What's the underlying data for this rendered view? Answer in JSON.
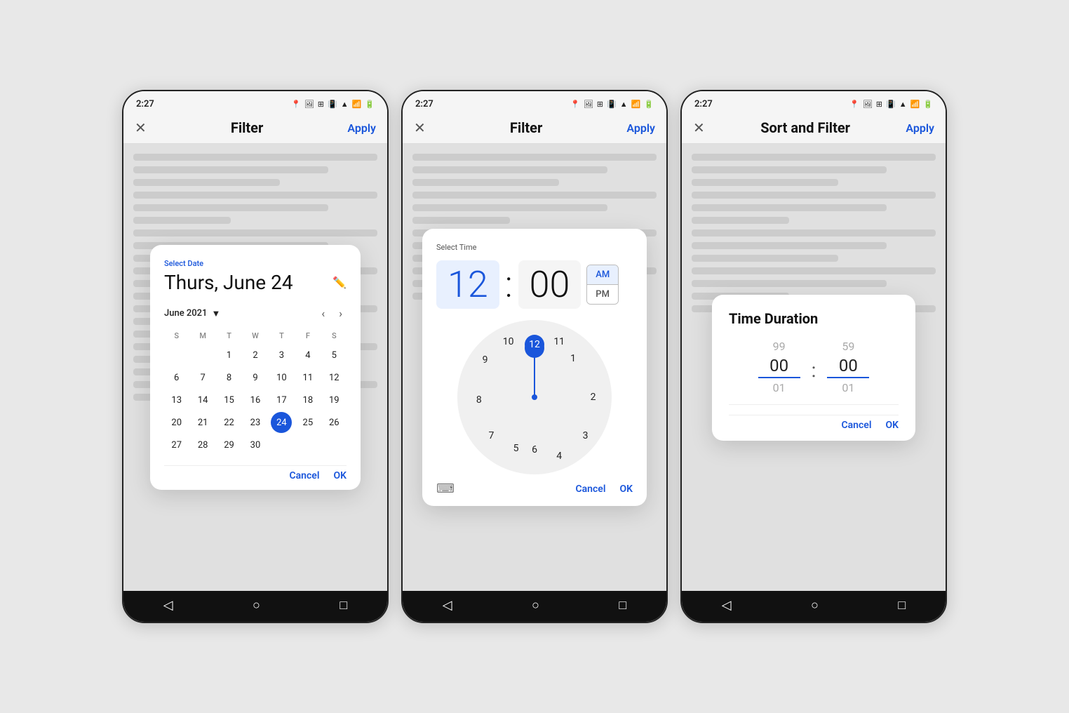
{
  "phones": [
    {
      "id": "date-picker",
      "statusTime": "2:27",
      "appBarTitle": "Filter",
      "applyLabel": "Apply",
      "dialog": {
        "type": "calendar",
        "selectLabel": "Select Date",
        "bigDate": "Thurs, June 24",
        "monthYear": "June 2021",
        "dayHeaders": [
          "S",
          "M",
          "T",
          "W",
          "T",
          "F",
          "S"
        ],
        "weeks": [
          [
            "",
            "",
            "1",
            "2",
            "3",
            "4",
            "5"
          ],
          [
            "6",
            "7",
            "8",
            "9",
            "10",
            "11",
            "12"
          ],
          [
            "13",
            "14",
            "15",
            "16",
            "17",
            "18",
            "19"
          ],
          [
            "20",
            "21",
            "22",
            "23",
            "24",
            "25",
            "26"
          ],
          [
            "27",
            "28",
            "29",
            "30",
            "",
            "",
            ""
          ]
        ],
        "selectedDay": "24",
        "cancelLabel": "Cancel",
        "okLabel": "OK"
      }
    },
    {
      "id": "time-picker",
      "statusTime": "2:27",
      "appBarTitle": "Filter",
      "applyLabel": "Apply",
      "dialog": {
        "type": "time",
        "selectLabel": "Select Time",
        "hours": "12",
        "minutes": "00",
        "amSelected": true,
        "amLabel": "AM",
        "pmLabel": "PM",
        "clockNumbers": [
          {
            "n": "12",
            "angle": 0,
            "r": 85
          },
          {
            "n": "1",
            "angle": 30,
            "r": 85
          },
          {
            "n": "2",
            "angle": 60,
            "r": 85
          },
          {
            "n": "3",
            "angle": 90,
            "r": 85
          },
          {
            "n": "4",
            "angle": 120,
            "r": 85
          },
          {
            "n": "5",
            "angle": 150,
            "r": 85
          },
          {
            "n": "6",
            "angle": 180,
            "r": 85
          },
          {
            "n": "7",
            "angle": 210,
            "r": 85
          },
          {
            "n": "8",
            "angle": 240,
            "r": 85
          },
          {
            "n": "9",
            "angle": 270,
            "r": 85
          },
          {
            "n": "10",
            "angle": 300,
            "r": 85
          },
          {
            "n": "11",
            "angle": 330,
            "r": 85
          }
        ],
        "cancelLabel": "Cancel",
        "okLabel": "OK"
      }
    },
    {
      "id": "sort-filter",
      "statusTime": "2:27",
      "appBarTitle": "Sort and Filter",
      "applyLabel": "Apply",
      "dialog": {
        "type": "duration",
        "title": "Time Duration",
        "aboveLeft": "99",
        "aboveRight": "59",
        "valueLeft": "00",
        "valueRight": "00",
        "belowLeft": "01",
        "belowRight": "01",
        "cancelLabel": "Cancel",
        "okLabel": "OK"
      }
    }
  ],
  "bgLines": [
    {
      "class": "long"
    },
    {
      "class": "medium"
    },
    {
      "class": "short"
    },
    {
      "class": "long"
    },
    {
      "class": "medium"
    },
    {
      "class": "xshort"
    },
    {
      "class": "long"
    },
    {
      "class": "medium"
    },
    {
      "class": "short"
    },
    {
      "class": "long"
    },
    {
      "class": "medium"
    },
    {
      "class": "xshort"
    },
    {
      "class": "long"
    },
    {
      "class": "medium"
    },
    {
      "class": "short"
    },
    {
      "class": "long"
    },
    {
      "class": "medium"
    },
    {
      "class": "xshort"
    },
    {
      "class": "long"
    },
    {
      "class": "medium"
    }
  ]
}
